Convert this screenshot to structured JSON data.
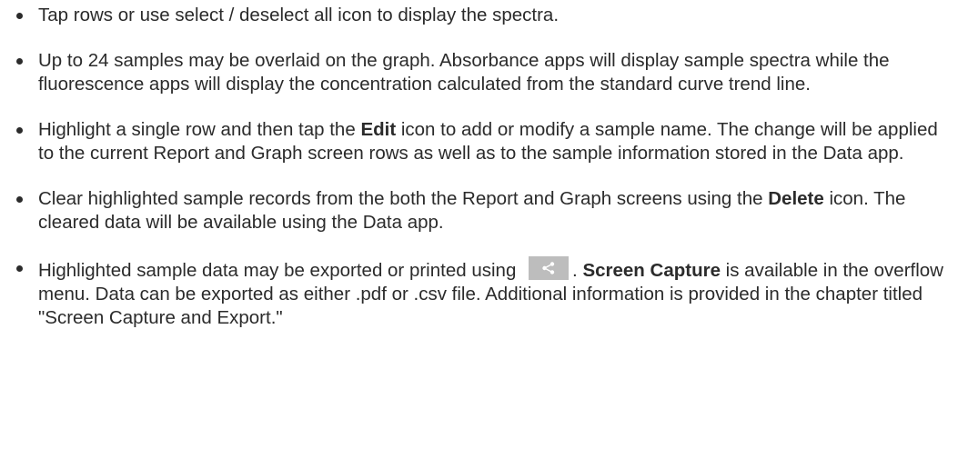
{
  "bullets": [
    {
      "text": "Tap rows or use select / deselect all icon to display the spectra."
    },
    {
      "text": "Up to 24 samples may be overlaid on the graph. Absorbance apps will display sample spectra while the fluorescence apps will display the concentration calculated from the standard curve trend line."
    },
    {
      "before": "Highlight a single row and then tap the ",
      "bold": "Edit",
      "after": " icon to add or modify a sample name. The change will be applied to the current Report and Graph screen rows as well as to the sample information stored in the Data app."
    },
    {
      "before": "Clear highlighted sample records from the both the Report and Graph screens using the ",
      "bold": "Delete",
      "after": " icon. The cleared data will be available using the Data app."
    },
    {
      "before": "Highlighted sample data may be exported or printed using ",
      "icon": "share-icon",
      "middle": ". ",
      "bold": "Screen Capture",
      "after": " is available in the overflow menu. Data can be exported as either .pdf or .csv file. Additional information is provided in the chapter titled \"Screen Capture and Export.\""
    }
  ],
  "colors": {
    "text": "#2b2b2b",
    "icon_bg": "#bdbdbd",
    "icon_fg": "#ffffff"
  }
}
